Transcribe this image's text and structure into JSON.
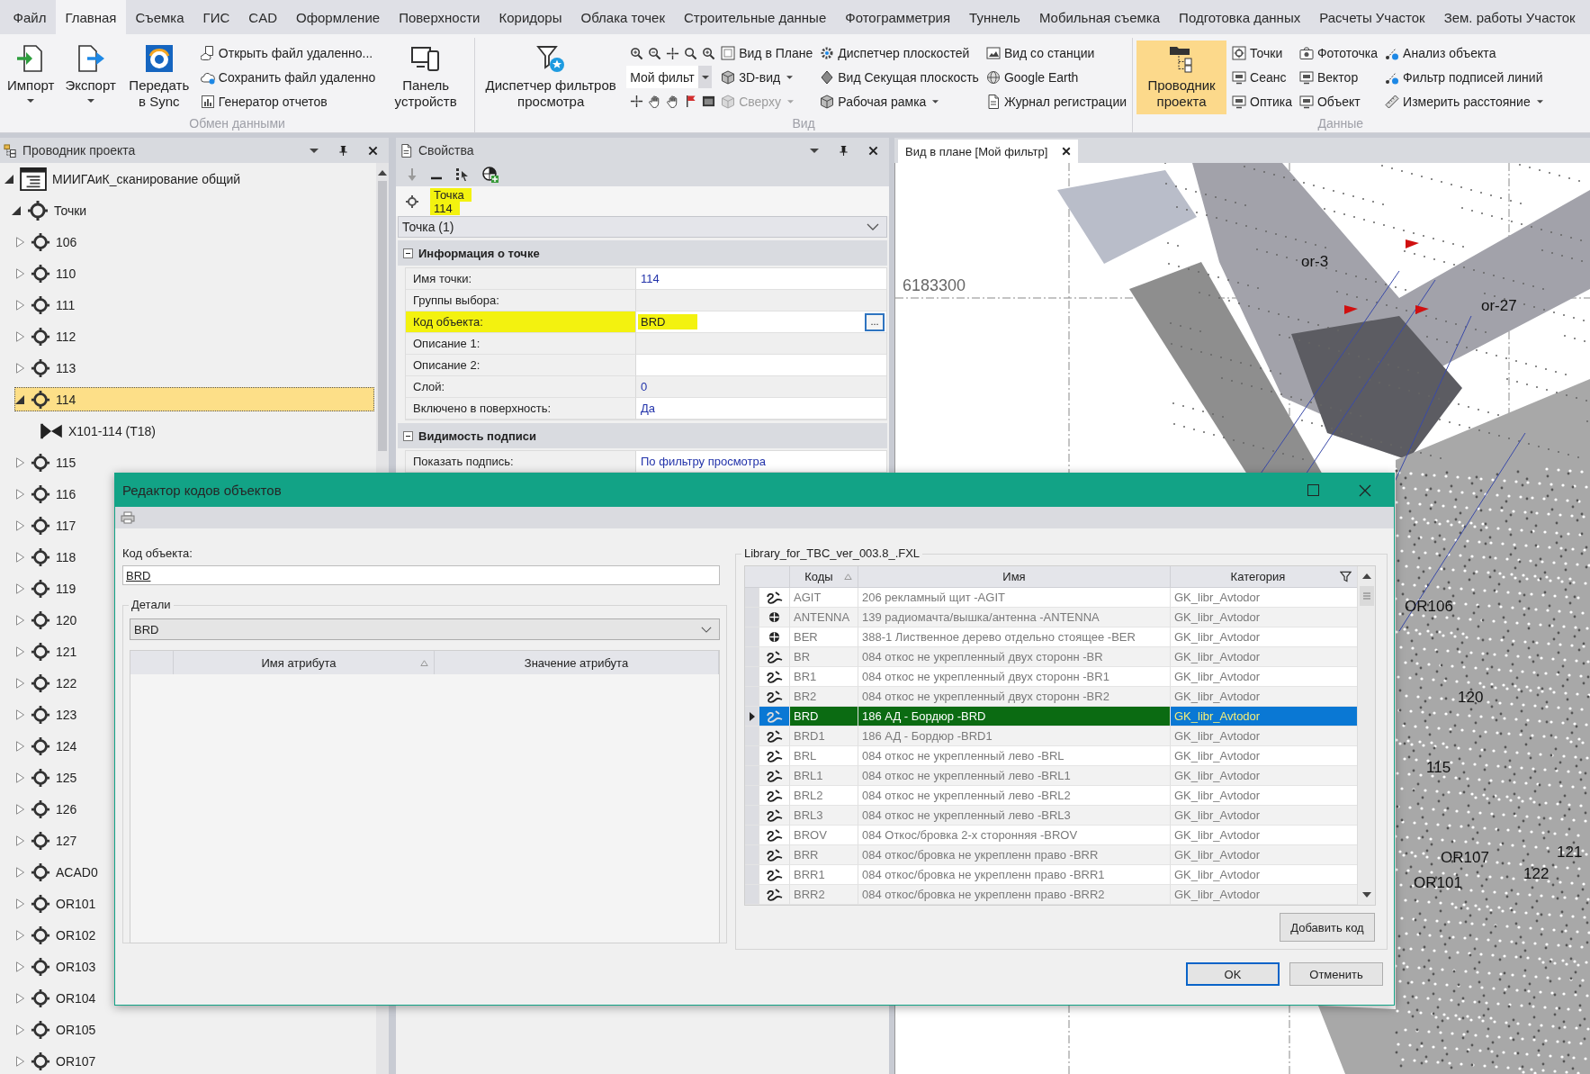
{
  "menu_tabs": [
    {
      "label": "Файл",
      "selected": false
    },
    {
      "label": "Главная",
      "selected": true
    },
    {
      "label": "Съемка",
      "selected": false
    },
    {
      "label": "ГИС",
      "selected": false
    },
    {
      "label": "CAD",
      "selected": false
    },
    {
      "label": "Оформление",
      "selected": false
    },
    {
      "label": "Поверхности",
      "selected": false
    },
    {
      "label": "Коридоры",
      "selected": false
    },
    {
      "label": "Облака точек",
      "selected": false
    },
    {
      "label": "Строительные данные",
      "selected": false
    },
    {
      "label": "Фотограмметрия",
      "selected": false
    },
    {
      "label": "Туннель",
      "selected": false
    },
    {
      "label": "Мобильная съемка",
      "selected": false
    },
    {
      "label": "Подготовка данных",
      "selected": false
    },
    {
      "label": "Расчеты Участок",
      "selected": false
    },
    {
      "label": "Зем. работы Участок",
      "selected": false
    }
  ],
  "ribbon": [
    {
      "label": "Обмен данными",
      "controls": [
        {
          "kind": "large",
          "label": "Импорт",
          "dropdown": true,
          "active": false
        },
        {
          "kind": "large",
          "label": "Экспорт",
          "dropdown": true,
          "active": false
        },
        {
          "kind": "large",
          "label": "Передать в Sync",
          "dropdown": false,
          "active": false
        },
        {
          "kind": "stack",
          "items": [
            {
              "label": "Открыть файл удаленно...",
              "dropdown": false,
              "disabled": false
            },
            {
              "label": "Сохранить файл удаленно",
              "dropdown": false,
              "disabled": false
            },
            {
              "label": "Генератор отчетов",
              "dropdown": false,
              "disabled": false
            }
          ]
        },
        {
          "kind": "large",
          "label": "Панель устройств",
          "dropdown": false,
          "active": false
        }
      ]
    },
    {
      "label": "Вид",
      "controls": [
        {
          "kind": "large",
          "label": "Диспетчер фильтров просмотра",
          "dropdown": false,
          "active": false
        },
        {
          "kind": "tools",
          "filter": "Мой фильт"
        },
        {
          "kind": "stack",
          "items": [
            {
              "label": "Вид в Плане",
              "dropdown": false,
              "disabled": false
            },
            {
              "label": "3D-вид",
              "dropdown": true,
              "disabled": false
            },
            {
              "label": "Сверху",
              "dropdown": true,
              "disabled": true
            }
          ]
        },
        {
          "kind": "stack",
          "items": [
            {
              "label": "Диспетчер плоскостей",
              "dropdown": false,
              "disabled": false
            },
            {
              "label": "Вид Секущая плоскость",
              "dropdown": false,
              "disabled": false
            },
            {
              "label": "Рабочая рамка",
              "dropdown": true,
              "disabled": false
            }
          ]
        },
        {
          "kind": "stack",
          "items": [
            {
              "label": "Вид со станции",
              "dropdown": false,
              "disabled": false
            },
            {
              "label": "Google Earth",
              "dropdown": false,
              "disabled": false
            },
            {
              "label": "Журнал регистрации",
              "dropdown": false,
              "disabled": false
            }
          ]
        }
      ]
    },
    {
      "label": "Данные",
      "controls": [
        {
          "kind": "large",
          "label": "Проводник проекта",
          "dropdown": false,
          "active": true
        },
        {
          "kind": "stack",
          "items": [
            {
              "label": "Точки",
              "dropdown": false,
              "disabled": false
            },
            {
              "label": "Сеанс",
              "dropdown": false,
              "disabled": false
            },
            {
              "label": "Оптика",
              "dropdown": false,
              "disabled": false
            }
          ]
        },
        {
          "kind": "stack",
          "items": [
            {
              "label": "Фототочка",
              "dropdown": false,
              "disabled": false
            },
            {
              "label": "Вектор",
              "dropdown": false,
              "disabled": false
            },
            {
              "label": "Объект",
              "dropdown": false,
              "disabled": false
            }
          ]
        },
        {
          "kind": "stack",
          "items": [
            {
              "label": "Анализ объекта",
              "dropdown": false,
              "disabled": false
            },
            {
              "label": "Фильтр подписей линий",
              "dropdown": false,
              "disabled": false
            },
            {
              "label": "Измерить расстояние",
              "dropdown": true,
              "disabled": false
            }
          ]
        }
      ]
    }
  ],
  "explorer": {
    "title": "Проводник проекта",
    "tree": [
      {
        "label": "МИИГАиК_сканирование общий",
        "kind": "project",
        "expanded": true,
        "selected": false,
        "children": [
          {
            "label": "Точки",
            "kind": "folder",
            "expanded": true,
            "selected": false,
            "children": [
              {
                "label": "106",
                "kind": "point",
                "expanded": false,
                "selected": false
              },
              {
                "label": "110",
                "kind": "point",
                "expanded": false,
                "selected": false
              },
              {
                "label": "111",
                "kind": "point",
                "expanded": false,
                "selected": false
              },
              {
                "label": "112",
                "kind": "point",
                "expanded": false,
                "selected": false
              },
              {
                "label": "113",
                "kind": "point",
                "expanded": false,
                "selected": false
              },
              {
                "label": "114",
                "kind": "point",
                "expanded": true,
                "selected": true,
                "children": [
                  {
                    "label": "X101-114 (T18)",
                    "kind": "observation",
                    "selected": false
                  }
                ]
              },
              {
                "label": "115",
                "kind": "point",
                "expanded": false,
                "selected": false
              },
              {
                "label": "116",
                "kind": "point",
                "expanded": false,
                "selected": false
              },
              {
                "label": "117",
                "kind": "point",
                "expanded": false,
                "selected": false
              },
              {
                "label": "118",
                "kind": "point",
                "expanded": false,
                "selected": false
              },
              {
                "label": "119",
                "kind": "point",
                "expanded": false,
                "selected": false
              },
              {
                "label": "120",
                "kind": "point",
                "expanded": false,
                "selected": false
              },
              {
                "label": "121",
                "kind": "point",
                "expanded": false,
                "selected": false
              },
              {
                "label": "122",
                "kind": "point",
                "expanded": false,
                "selected": false
              },
              {
                "label": "123",
                "kind": "point",
                "expanded": false,
                "selected": false
              },
              {
                "label": "124",
                "kind": "point",
                "expanded": false,
                "selected": false
              },
              {
                "label": "125",
                "kind": "point",
                "expanded": false,
                "selected": false
              },
              {
                "label": "126",
                "kind": "point",
                "expanded": false,
                "selected": false
              },
              {
                "label": "127",
                "kind": "point",
                "expanded": false,
                "selected": false
              },
              {
                "label": "ACAD0",
                "kind": "point",
                "expanded": false,
                "selected": false
              },
              {
                "label": "OR101",
                "kind": "point",
                "expanded": false,
                "selected": false
              },
              {
                "label": "OR102",
                "kind": "point",
                "expanded": false,
                "selected": false
              },
              {
                "label": "OR103",
                "kind": "point",
                "expanded": false,
                "selected": false
              },
              {
                "label": "OR104",
                "kind": "point",
                "expanded": false,
                "selected": false
              },
              {
                "label": "OR105",
                "kind": "point",
                "expanded": false,
                "selected": false
              },
              {
                "label": "OR107",
                "kind": "point",
                "expanded": false,
                "selected": false
              }
            ]
          }
        ]
      }
    ]
  },
  "properties": {
    "title": "Свойства",
    "object": {
      "type": "Точка",
      "name": "114",
      "highlighted": true
    },
    "selector": "Точка (1)",
    "sections": [
      {
        "title": "Информация о точке",
        "expanded": true,
        "rows": [
          {
            "label": "Имя точки:",
            "value": "114",
            "kind": "static",
            "highlighted": false
          },
          {
            "label": "Группы выбора:",
            "highlighted": false
          },
          {
            "label": "Код объекта:",
            "value": "BRD",
            "kind": "editable",
            "button": "...",
            "highlighted": true
          },
          {
            "label": "Описание 1:",
            "highlighted": false
          },
          {
            "label": "Описание 2:",
            "highlighted": false
          },
          {
            "label": "Слой:",
            "value": "0",
            "kind": "static",
            "highlighted": false
          },
          {
            "label": "Включено в поверхность:",
            "value": "Да",
            "kind": "static",
            "highlighted": false
          }
        ]
      },
      {
        "title": "Видимость подписи",
        "expanded": true,
        "rows": [
          {
            "label": "Показать подпись:",
            "value": "По фильтру просмотра",
            "kind": "static",
            "highlighted": false
          }
        ]
      }
    ]
  },
  "map_view": {
    "tab": "Вид в плане [Мой фильтр]",
    "grid_label": "6183300",
    "labels": [
      "or-3",
      "or-27",
      "OR106",
      "120",
      "115",
      "OR107",
      "OR101",
      "121",
      "122"
    ]
  },
  "code_editor": {
    "title": "Редактор кодов объектов",
    "code_field": {
      "label": "Код объекта:",
      "value": "BRD"
    },
    "details": {
      "label": "Детали",
      "value": "BRD",
      "columns": [
        {
          "label": "Имя атрибута",
          "sorted": true
        },
        {
          "label": "Значение атрибута",
          "sorted": false
        }
      ]
    },
    "library": "Library_for_TBC_ver_003.8_.FXL",
    "columns": [
      {
        "label": "Коды",
        "sorted": true,
        "filter": false
      },
      {
        "label": "Имя",
        "sorted": false,
        "filter": false
      },
      {
        "label": "Категория",
        "sorted": false,
        "filter": true
      }
    ],
    "rows": [
      {
        "code": "AGIT",
        "name": "206 рекламный щит -AGIT",
        "category": "GK_libr_Avtodor",
        "kind": "line",
        "selected": false,
        "highlighted": false
      },
      {
        "code": "ANTENNA",
        "name": "139 радиомачта/вышка/антенна -ANTENNA",
        "category": "GK_libr_Avtodor",
        "kind": "point",
        "selected": false,
        "highlighted": false
      },
      {
        "code": "BER",
        "name": "388-1 Лиственное дерево отдельно стоящее -BER",
        "category": "GK_libr_Avtodor",
        "kind": "point",
        "selected": false,
        "highlighted": false
      },
      {
        "code": "BR",
        "name": "084 откос не укрепленный двух сторонн -BR",
        "category": "GK_libr_Avtodor",
        "kind": "line",
        "selected": false,
        "highlighted": false
      },
      {
        "code": "BR1",
        "name": "084 откос не укрепленный двух сторонн -BR1",
        "category": "GK_libr_Avtodor",
        "kind": "line",
        "selected": false,
        "highlighted": false
      },
      {
        "code": "BR2",
        "name": "084 откос не укрепленный двух сторонн -BR2",
        "category": "GK_libr_Avtodor",
        "kind": "line",
        "selected": false,
        "highlighted": false
      },
      {
        "code": "BRD",
        "name": "186 АД - Бордюр -BRD",
        "category": "GK_libr_Avtodor",
        "kind": "line",
        "selected": true,
        "highlighted": true
      },
      {
        "code": "BRD1",
        "name": "186 АД - Бордюр -BRD1",
        "category": "GK_libr_Avtodor",
        "kind": "line",
        "selected": false,
        "highlighted": false
      },
      {
        "code": "BRL",
        "name": "084 откос не укрепленный лево -BRL",
        "category": "GK_libr_Avtodor",
        "kind": "line",
        "selected": false,
        "highlighted": false
      },
      {
        "code": "BRL1",
        "name": "084 откос не укрепленный лево -BRL1",
        "category": "GK_libr_Avtodor",
        "kind": "line",
        "selected": false,
        "highlighted": false
      },
      {
        "code": "BRL2",
        "name": "084 откос не укрепленный лево -BRL2",
        "category": "GK_libr_Avtodor",
        "kind": "line",
        "selected": false,
        "highlighted": false
      },
      {
        "code": "BRL3",
        "name": "084 откос не укрепленный лево -BRL3",
        "category": "GK_libr_Avtodor",
        "kind": "line",
        "selected": false,
        "highlighted": false
      },
      {
        "code": "BROV",
        "name": "084 Откос/бровка 2-х сторонняя -BROV",
        "category": "GK_libr_Avtodor",
        "kind": "line",
        "selected": false,
        "highlighted": false
      },
      {
        "code": "BRR",
        "name": "084 откос/бровка не укрепленн право -BRR",
        "category": "GK_libr_Avtodor",
        "kind": "line",
        "selected": false,
        "highlighted": false
      },
      {
        "code": "BRR1",
        "name": "084 откос/бровка не укрепленн право -BRR1",
        "category": "GK_libr_Avtodor",
        "kind": "line",
        "selected": false,
        "highlighted": false
      },
      {
        "code": "BRR2",
        "name": "084 откос/бровка не укрепленн право -BRR2",
        "category": "GK_libr_Avtodor",
        "kind": "line",
        "selected": false,
        "highlighted": false
      }
    ],
    "add_button": "Добавить код",
    "ok_button": "OK",
    "cancel_button": "Отменить"
  }
}
